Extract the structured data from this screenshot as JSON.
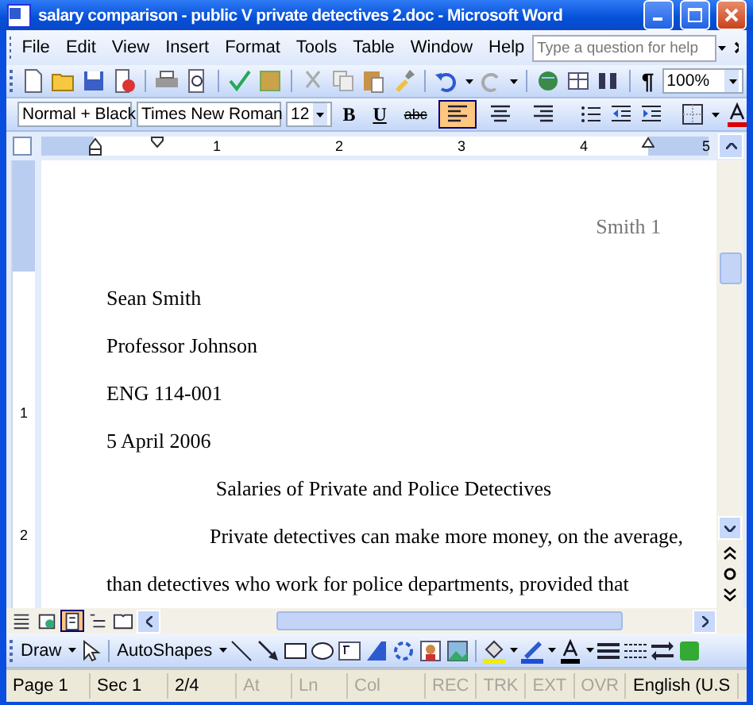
{
  "window": {
    "title": "salary comparison - public V private detectives 2.doc - Microsoft Word"
  },
  "menu": [
    "File",
    "Edit",
    "View",
    "Insert",
    "Format",
    "Tools",
    "Table",
    "Window",
    "Help"
  ],
  "help_box": {
    "placeholder": "Type a question for help"
  },
  "standard_toolbar": {
    "pilcrow": "¶",
    "zoom": "100%"
  },
  "formatting_toolbar": {
    "style": "Normal + Black",
    "font": "Times New Roman",
    "size": "12",
    "bold": "B",
    "underline": "U",
    "strike": "abc",
    "alignments": [
      {
        "kind": "left",
        "selected": true
      },
      {
        "kind": "center",
        "selected": false
      },
      {
        "kind": "right",
        "selected": false
      }
    ]
  },
  "ruler": {
    "numbers": [
      "1",
      "2",
      "3",
      "4",
      "5"
    ]
  },
  "vertical_ruler": {
    "numbers": [
      "1",
      "2"
    ]
  },
  "document": {
    "header": "Smith 1",
    "lines": [
      {
        "kind": "plain",
        "text": "Sean Smith"
      },
      {
        "kind": "plain",
        "text": "Professor Johnson"
      },
      {
        "kind": "plain",
        "text": "ENG 114-001"
      },
      {
        "kind": "plain",
        "text": "5 April 2006"
      },
      {
        "kind": "center",
        "text": "Salaries of Private and Police Detectives"
      },
      {
        "kind": "indent",
        "text": "Private detectives can make more money, on the average,"
      },
      {
        "kind": "plain",
        "text": "than detectives who work for police departments, provided that"
      }
    ]
  },
  "views": [
    {
      "kind": "normal",
      "selected": false
    },
    {
      "kind": "web",
      "selected": false
    },
    {
      "kind": "print",
      "selected": true
    },
    {
      "kind": "outline",
      "selected": false
    },
    {
      "kind": "reading",
      "selected": false
    }
  ],
  "drawing_toolbar": {
    "draw": "Draw",
    "autoshapes": "AutoShapes"
  },
  "status_bar": [
    {
      "text": "Page 1",
      "disabled": false
    },
    {
      "text": "Sec 1",
      "disabled": false
    },
    {
      "text": "2/4",
      "disabled": false
    },
    {
      "text": "At",
      "disabled": true
    },
    {
      "text": "Ln",
      "disabled": true
    },
    {
      "text": "Col",
      "disabled": true
    },
    {
      "text": "REC",
      "disabled": true
    },
    {
      "text": "TRK",
      "disabled": true
    },
    {
      "text": "EXT",
      "disabled": true
    },
    {
      "text": "OVR",
      "disabled": true
    },
    {
      "text": "English (U.S",
      "disabled": false
    }
  ]
}
